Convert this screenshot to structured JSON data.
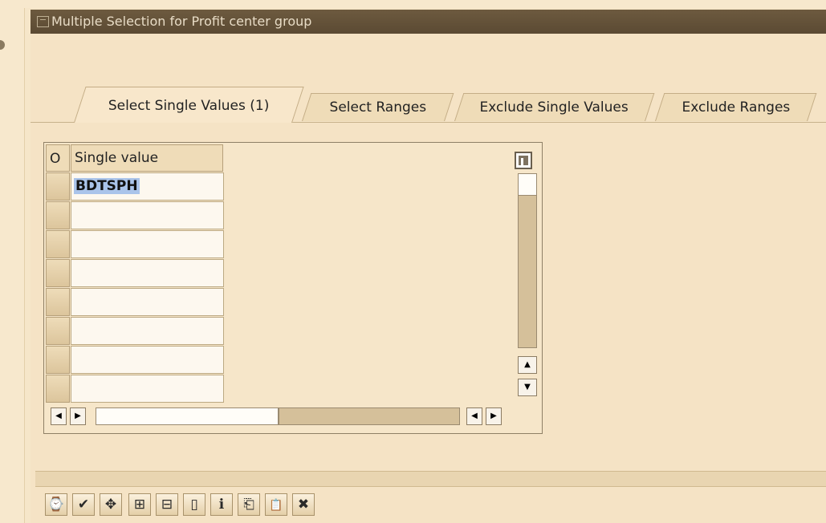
{
  "window": {
    "title": "Multiple Selection for Profit center group"
  },
  "tabs": [
    {
      "label": "Select Single Values (1)"
    },
    {
      "label": "Select Ranges"
    },
    {
      "label": "Exclude Single Values"
    },
    {
      "label": "Exclude Ranges"
    }
  ],
  "table": {
    "columns": {
      "o": "O",
      "value": "Single value"
    },
    "rows": [
      {
        "value": "BDTSPH"
      },
      {
        "value": ""
      },
      {
        "value": ""
      },
      {
        "value": ""
      },
      {
        "value": ""
      },
      {
        "value": ""
      },
      {
        "value": ""
      },
      {
        "value": ""
      }
    ]
  },
  "scroll": {
    "up_glyph": "▲",
    "down_glyph": "▼",
    "left_glyph": "◀",
    "right_glyph": "▶"
  },
  "toolbar": {
    "buttons": [
      {
        "name": "execute-button",
        "icon": "clock-execute-icon",
        "glyph": "⌚"
      },
      {
        "name": "copy-button",
        "icon": "checkmark-icon",
        "glyph": "✔"
      },
      {
        "name": "multiple-selection-button",
        "icon": "arrows-icon",
        "glyph": "✥"
      },
      {
        "name": "insert-line-button",
        "icon": "insert-row-icon",
        "glyph": "⊞"
      },
      {
        "name": "delete-line-button",
        "icon": "remove-row-icon",
        "glyph": "⊟"
      },
      {
        "name": "delete-all-button",
        "icon": "trash-icon",
        "glyph": "▯"
      },
      {
        "name": "help-button",
        "icon": "info-icon",
        "glyph": "ℹ"
      },
      {
        "name": "import-button",
        "icon": "import-icon",
        "glyph": "⎗"
      },
      {
        "name": "upload-clipboard-button",
        "icon": "clipboard-icon",
        "glyph": "📋"
      },
      {
        "name": "cancel-button",
        "icon": "close-icon",
        "glyph": "✖"
      }
    ]
  }
}
